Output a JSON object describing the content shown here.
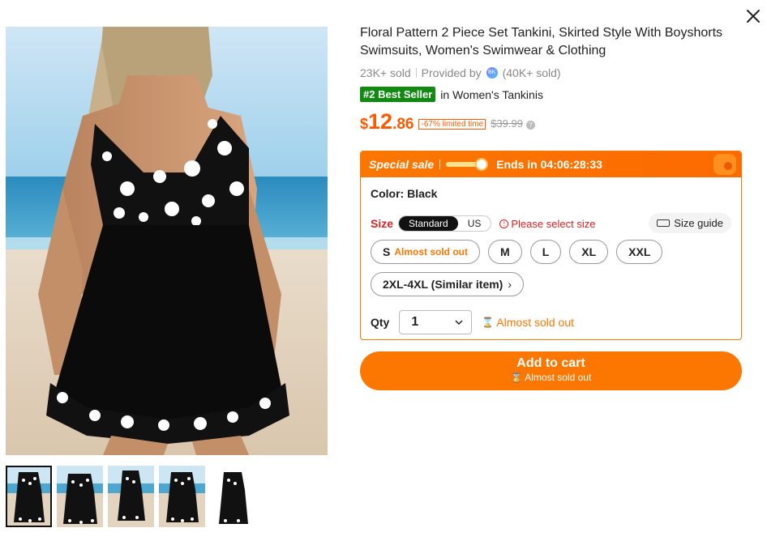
{
  "product": {
    "title": "Floral Pattern 2 Piece Set Tankini, Skirted Style With Boyshorts Swimsuits, Women's Swimwear & Clothing",
    "sold": "23K+ sold",
    "provided_by": "Provided by",
    "store_sold": "(40K+ sold)",
    "best_seller_badge": "#2 Best Seller",
    "best_seller_category": "in Women's Tankinis",
    "price_currency": "$",
    "price_int": "12",
    "price_dec": ".86",
    "discount": "-67% limited time",
    "original_price": "$39.99"
  },
  "sale": {
    "title": "Special sale",
    "ends": "Ends in 04:06:28:33",
    "progress": 0.85
  },
  "options": {
    "color_label": "Color: Black",
    "size_label": "Size",
    "size_system": [
      "Standard",
      "US"
    ],
    "size_warning": "Please select size",
    "size_guide": "Size guide",
    "sizes": [
      {
        "label": "S",
        "note": "Almost sold out"
      },
      {
        "label": "M",
        "note": ""
      },
      {
        "label": "L",
        "note": ""
      },
      {
        "label": "XL",
        "note": ""
      },
      {
        "label": "XXL",
        "note": ""
      },
      {
        "label": "2XL-4XL (Similar item)",
        "note": ""
      }
    ],
    "qty_label": "Qty",
    "qty_value": "1",
    "qty_warning": "Almost sold out"
  },
  "cart": {
    "label": "Add to cart",
    "sub": "Almost sold out"
  },
  "icons": {
    "close": "close-icon",
    "info": "info-icon",
    "ruler": "ruler-icon",
    "hourglass": "hourglass-icon",
    "chevron": "chevron-down-icon"
  },
  "colors": {
    "accent": "#fb7701",
    "price": "#fb5a00",
    "warning": "#e02020",
    "best_seller": "#128a12"
  }
}
